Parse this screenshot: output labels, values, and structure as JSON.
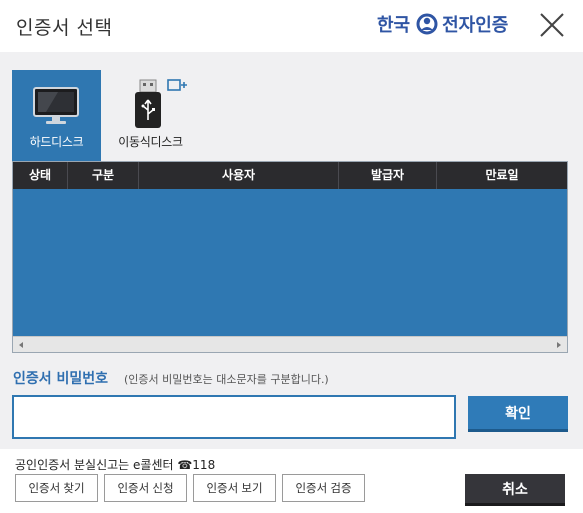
{
  "header": {
    "title": "인증서 선택",
    "brand_part1": "한국",
    "brand_part2": "전자인증",
    "close_icon": "close-icon"
  },
  "tabs": [
    {
      "label": "하드디스크",
      "icon": "monitor-icon",
      "active": true
    },
    {
      "label": "이동식디스크",
      "icon": "usb-drive-icon",
      "active": false
    }
  ],
  "table": {
    "columns": [
      "상태",
      "구분",
      "사용자",
      "발급자",
      "만료일"
    ],
    "rows": []
  },
  "password": {
    "label": "인증서 비밀번호",
    "hint": "(인증서 비밀번호는 대소문자를 구분합니다.)",
    "value": "",
    "placeholder": ""
  },
  "buttons": {
    "ok": "확인",
    "cancel": "취소"
  },
  "footer": {
    "lost_notice": "공인인증서 분실신고는 e콜센터 ☎118",
    "find": "인증서 찾기",
    "apply": "인증서 신청",
    "view": "인증서 보기",
    "verify": "인증서 검증"
  },
  "colors": {
    "accent": "#2f77b1",
    "table_header": "#2b2b2e",
    "table_body": "#2f78b2",
    "cancel": "#35353a",
    "panel": "#f0f0f2"
  }
}
